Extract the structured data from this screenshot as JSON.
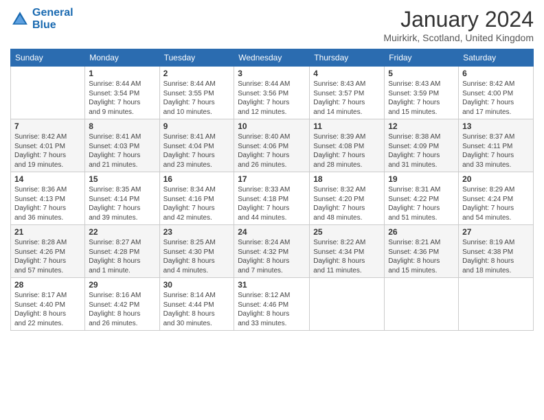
{
  "logo": {
    "line1": "General",
    "line2": "Blue"
  },
  "title": "January 2024",
  "subtitle": "Muirkirk, Scotland, United Kingdom",
  "days_of_week": [
    "Sunday",
    "Monday",
    "Tuesday",
    "Wednesday",
    "Thursday",
    "Friday",
    "Saturday"
  ],
  "weeks": [
    [
      {
        "day": "",
        "info": ""
      },
      {
        "day": "1",
        "info": "Sunrise: 8:44 AM\nSunset: 3:54 PM\nDaylight: 7 hours\nand 9 minutes."
      },
      {
        "day": "2",
        "info": "Sunrise: 8:44 AM\nSunset: 3:55 PM\nDaylight: 7 hours\nand 10 minutes."
      },
      {
        "day": "3",
        "info": "Sunrise: 8:44 AM\nSunset: 3:56 PM\nDaylight: 7 hours\nand 12 minutes."
      },
      {
        "day": "4",
        "info": "Sunrise: 8:43 AM\nSunset: 3:57 PM\nDaylight: 7 hours\nand 14 minutes."
      },
      {
        "day": "5",
        "info": "Sunrise: 8:43 AM\nSunset: 3:59 PM\nDaylight: 7 hours\nand 15 minutes."
      },
      {
        "day": "6",
        "info": "Sunrise: 8:42 AM\nSunset: 4:00 PM\nDaylight: 7 hours\nand 17 minutes."
      }
    ],
    [
      {
        "day": "7",
        "info": "Sunrise: 8:42 AM\nSunset: 4:01 PM\nDaylight: 7 hours\nand 19 minutes."
      },
      {
        "day": "8",
        "info": "Sunrise: 8:41 AM\nSunset: 4:03 PM\nDaylight: 7 hours\nand 21 minutes."
      },
      {
        "day": "9",
        "info": "Sunrise: 8:41 AM\nSunset: 4:04 PM\nDaylight: 7 hours\nand 23 minutes."
      },
      {
        "day": "10",
        "info": "Sunrise: 8:40 AM\nSunset: 4:06 PM\nDaylight: 7 hours\nand 26 minutes."
      },
      {
        "day": "11",
        "info": "Sunrise: 8:39 AM\nSunset: 4:08 PM\nDaylight: 7 hours\nand 28 minutes."
      },
      {
        "day": "12",
        "info": "Sunrise: 8:38 AM\nSunset: 4:09 PM\nDaylight: 7 hours\nand 31 minutes."
      },
      {
        "day": "13",
        "info": "Sunrise: 8:37 AM\nSunset: 4:11 PM\nDaylight: 7 hours\nand 33 minutes."
      }
    ],
    [
      {
        "day": "14",
        "info": "Sunrise: 8:36 AM\nSunset: 4:13 PM\nDaylight: 7 hours\nand 36 minutes."
      },
      {
        "day": "15",
        "info": "Sunrise: 8:35 AM\nSunset: 4:14 PM\nDaylight: 7 hours\nand 39 minutes."
      },
      {
        "day": "16",
        "info": "Sunrise: 8:34 AM\nSunset: 4:16 PM\nDaylight: 7 hours\nand 42 minutes."
      },
      {
        "day": "17",
        "info": "Sunrise: 8:33 AM\nSunset: 4:18 PM\nDaylight: 7 hours\nand 44 minutes."
      },
      {
        "day": "18",
        "info": "Sunrise: 8:32 AM\nSunset: 4:20 PM\nDaylight: 7 hours\nand 48 minutes."
      },
      {
        "day": "19",
        "info": "Sunrise: 8:31 AM\nSunset: 4:22 PM\nDaylight: 7 hours\nand 51 minutes."
      },
      {
        "day": "20",
        "info": "Sunrise: 8:29 AM\nSunset: 4:24 PM\nDaylight: 7 hours\nand 54 minutes."
      }
    ],
    [
      {
        "day": "21",
        "info": "Sunrise: 8:28 AM\nSunset: 4:26 PM\nDaylight: 7 hours\nand 57 minutes."
      },
      {
        "day": "22",
        "info": "Sunrise: 8:27 AM\nSunset: 4:28 PM\nDaylight: 8 hours\nand 1 minute."
      },
      {
        "day": "23",
        "info": "Sunrise: 8:25 AM\nSunset: 4:30 PM\nDaylight: 8 hours\nand 4 minutes."
      },
      {
        "day": "24",
        "info": "Sunrise: 8:24 AM\nSunset: 4:32 PM\nDaylight: 8 hours\nand 7 minutes."
      },
      {
        "day": "25",
        "info": "Sunrise: 8:22 AM\nSunset: 4:34 PM\nDaylight: 8 hours\nand 11 minutes."
      },
      {
        "day": "26",
        "info": "Sunrise: 8:21 AM\nSunset: 4:36 PM\nDaylight: 8 hours\nand 15 minutes."
      },
      {
        "day": "27",
        "info": "Sunrise: 8:19 AM\nSunset: 4:38 PM\nDaylight: 8 hours\nand 18 minutes."
      }
    ],
    [
      {
        "day": "28",
        "info": "Sunrise: 8:17 AM\nSunset: 4:40 PM\nDaylight: 8 hours\nand 22 minutes."
      },
      {
        "day": "29",
        "info": "Sunrise: 8:16 AM\nSunset: 4:42 PM\nDaylight: 8 hours\nand 26 minutes."
      },
      {
        "day": "30",
        "info": "Sunrise: 8:14 AM\nSunset: 4:44 PM\nDaylight: 8 hours\nand 30 minutes."
      },
      {
        "day": "31",
        "info": "Sunrise: 8:12 AM\nSunset: 4:46 PM\nDaylight: 8 hours\nand 33 minutes."
      },
      {
        "day": "",
        "info": ""
      },
      {
        "day": "",
        "info": ""
      },
      {
        "day": "",
        "info": ""
      }
    ]
  ]
}
